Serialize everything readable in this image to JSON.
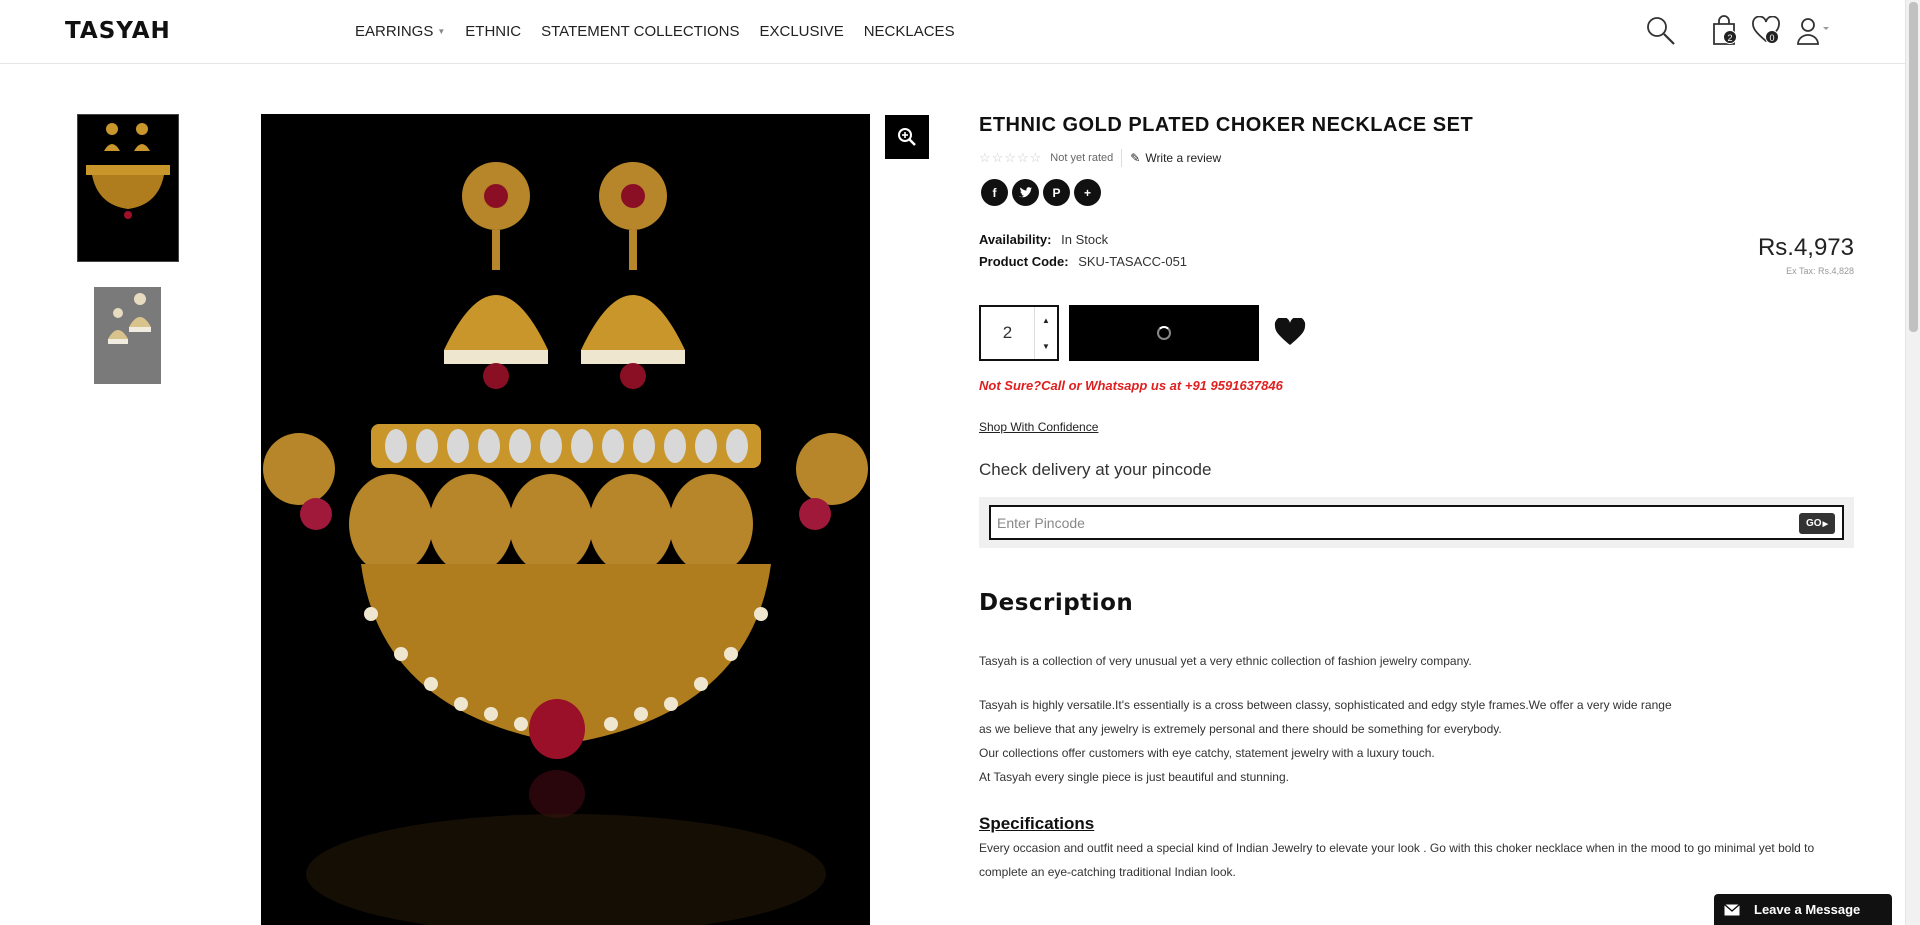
{
  "brand": {
    "logo": "TASYAH"
  },
  "nav": {
    "items": [
      {
        "label": "EARRINGS",
        "has_dropdown": true
      },
      {
        "label": "ETHNIC"
      },
      {
        "label": "STATEMENT COLLECTIONS"
      },
      {
        "label": "EXCLUSIVE"
      },
      {
        "label": "NECKLACES"
      }
    ]
  },
  "header": {
    "icons": [
      "search-icon",
      "cart-icon",
      "heart-icon",
      "user-icon"
    ],
    "cart_count": "2",
    "wishlist_count": "0"
  },
  "product": {
    "title": "ETHNIC GOLD PLATED CHOKER NECKLACE SET",
    "stars": "☆☆☆☆☆",
    "rating_text": "Not yet rated",
    "write_review": "Write a review",
    "share_icons": [
      "facebook-icon",
      "twitter-icon",
      "pinterest-icon",
      "plus-icon"
    ],
    "availability_label": "Availability:",
    "availability_value": "In Stock",
    "code_label": "Product Code:",
    "code_value": "SKU-TASACC-051",
    "price": "Rs.4,973",
    "ex_tax": "Ex Tax: Rs.4,828",
    "quantity": "2",
    "callout": "Not Sure?Call or Whatsapp us at +91 9591637846",
    "shop_confidence": "Shop With Confidence"
  },
  "pincode": {
    "heading": "Check delivery at your pincode",
    "placeholder": "Enter Pincode",
    "go_label": "GO"
  },
  "description": {
    "heading": "Description",
    "paragraphs": [
      "Tasyah is a collection of very unusual yet a very ethnic collection of fashion jewelry company.",
      "Tasyah is highly versatile.It's essentially is a cross between classy, sophisticated and edgy style frames.We offer a very wide range",
      "as we believe that any jewelry is extremely personal and there should be something for everybody.",
      "Our collections offer customers with eye catchy, statement jewelry with a luxury touch.",
      "At Tasyah every single piece is just beautiful and stunning."
    ]
  },
  "specifications": {
    "heading": "Specifications",
    "text": "Every occasion and outfit need a special kind of Indian Jewelry to elevate your look . Go with this choker necklace when in the mood to go minimal yet bold to complete an eye-catching traditional Indian look."
  },
  "chat": {
    "label": "Leave a Message"
  },
  "colors": {
    "accent_red": "#e02020",
    "gold": "#c9962c",
    "black": "#000000"
  }
}
